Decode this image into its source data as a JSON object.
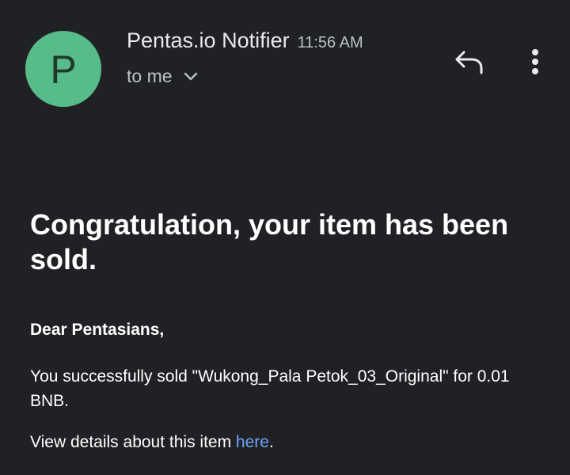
{
  "email": {
    "sender": {
      "avatar_letter": "P",
      "avatar_color": "#57bb8a",
      "name": "Pentas.io Notifier",
      "time": "11:56 AM"
    },
    "recipient": {
      "label": "to me",
      "expand_icon": "chevron-down-icon"
    },
    "actions": {
      "reply_icon": "reply-icon",
      "more_icon": "more-vert-icon"
    },
    "body": {
      "headline": "Congratulation, your item has been sold.",
      "greeting": "Dear Pentasians,",
      "message": "You successfully sold \"Wukong_Pala Petok_03_Original\" for 0.01 BNB.",
      "details_prefix": "View details about this item ",
      "details_link": "here",
      "details_suffix": ".",
      "link_color": "#6ea3f5"
    }
  }
}
